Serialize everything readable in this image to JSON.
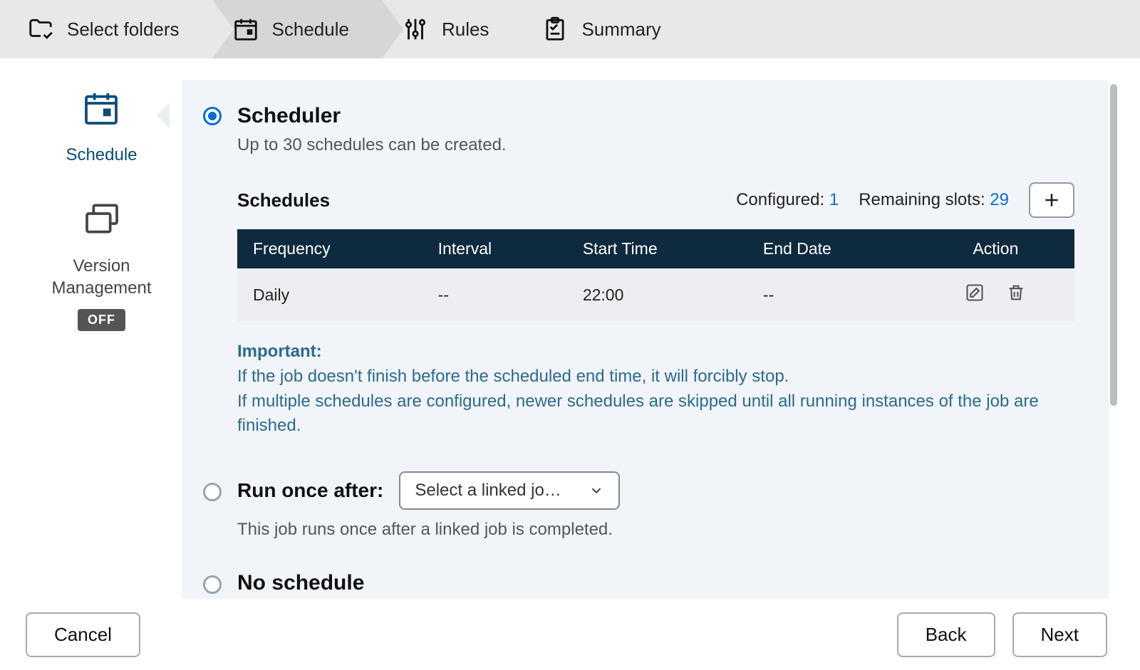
{
  "stepper": {
    "steps": [
      {
        "label": "Select folders"
      },
      {
        "label": "Schedule"
      },
      {
        "label": "Rules"
      },
      {
        "label": "Summary"
      }
    ],
    "active_index": 1
  },
  "sidebar": {
    "items": [
      {
        "label": "Schedule"
      },
      {
        "label": "Version\nManagement",
        "badge": "OFF"
      }
    ]
  },
  "scheduler": {
    "title": "Scheduler",
    "subtitle": "Up to 30 schedules can be created.",
    "table_title": "Schedules",
    "configured_label": "Configured:",
    "configured_value": "1",
    "remaining_label": "Remaining slots:",
    "remaining_value": "29",
    "columns": [
      "Frequency",
      "Interval",
      "Start Time",
      "End Date",
      "Action"
    ],
    "rows": [
      {
        "frequency": "Daily",
        "interval": "--",
        "start_time": "22:00",
        "end_date": "--"
      }
    ],
    "important_label": "Important:",
    "important_text": "If the job doesn't finish before the scheduled end time, it will forcibly stop.\nIf multiple schedules are configured, newer schedules are skipped until all running instances of the job are finished."
  },
  "run_once": {
    "title": "Run once after:",
    "select_placeholder": "Select a linked jo…",
    "description": "This job runs once after a linked job is completed."
  },
  "no_schedule": {
    "title": "No schedule"
  },
  "footer": {
    "cancel": "Cancel",
    "back": "Back",
    "next": "Next"
  }
}
